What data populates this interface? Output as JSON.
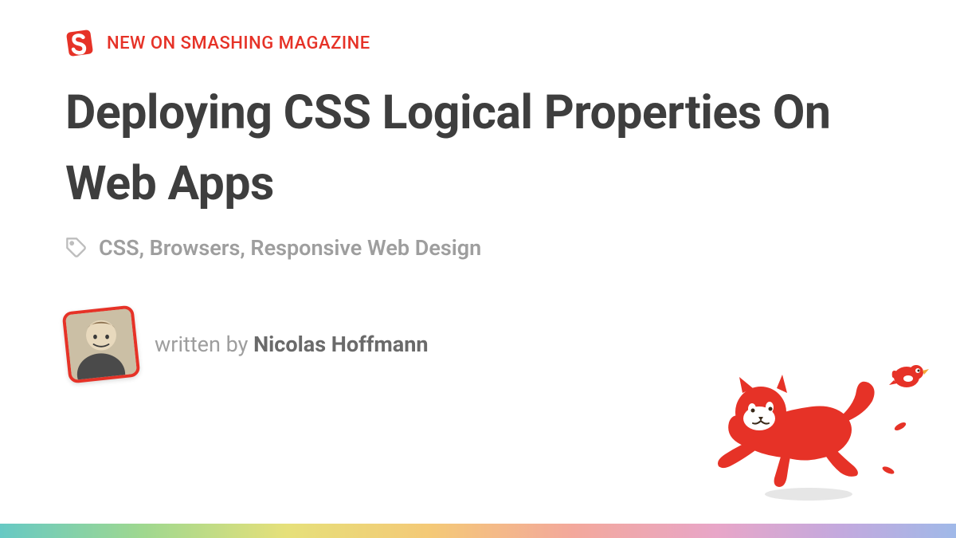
{
  "header": {
    "label": "NEW ON SMASHING MAGAZINE"
  },
  "article": {
    "title": "Deploying CSS Logical Properties On Web Apps",
    "tags": "CSS, Browsers, Responsive Web Design",
    "written_by_prefix": "written by ",
    "author_name": "Nicolas Hoffmann"
  },
  "colors": {
    "brand": "#e63227"
  }
}
